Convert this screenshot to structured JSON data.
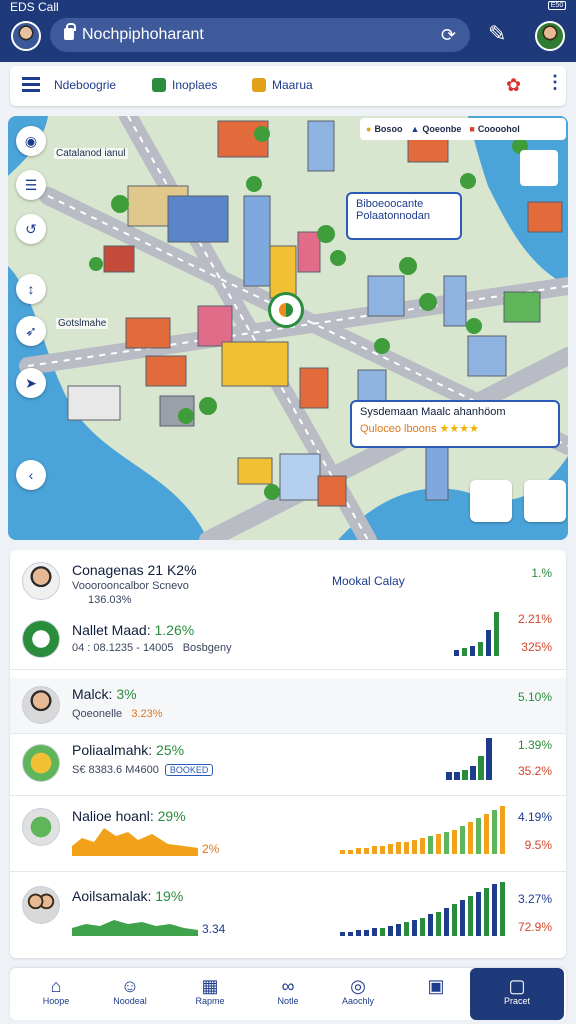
{
  "status": {
    "left": "EDS Call",
    "battery": "E50"
  },
  "browser": {
    "url": "Nochpiphoharant"
  },
  "header": {
    "nav": [
      {
        "label": "Ndeboogrie",
        "icon": "map-icon",
        "color": "#1e3c8c"
      },
      {
        "label": "Inoplaes",
        "icon": "chat-icon",
        "color": "#2a8d3c"
      },
      {
        "label": "Maarua",
        "icon": "bus-icon",
        "color": "#e1a21a"
      }
    ]
  },
  "map": {
    "legend": [
      "Bosoo",
      "Qoeonbe",
      "Coooohol"
    ],
    "label_top": "Catalanod ianul",
    "label_left": "Gotslmahe",
    "callout1": "Biboeoocante\nPolaatonnodan",
    "callout2_title": "Sysdemaan Maalc ahanhöom",
    "callout2_sub": "Quloceo lboons"
  },
  "list": {
    "rows": [
      {
        "title": "Conagenas 21 K2%",
        "sub": "Vooorooncalbor Scnevo",
        "sub2": "136.03%",
        "mid": "Mookal Calay",
        "val": "1.%",
        "val_color": "green"
      },
      {
        "title": "Nallet Maad:",
        "pct": "1.26%",
        "sub": "04 : 08.1235 - 14005",
        "sub2": "Bosbgeny",
        "val": "2.21%",
        "val2": "325%",
        "val_color": "red"
      },
      {
        "title": "Malck:",
        "pct": "3%",
        "sub": "Qoeonelle",
        "sub2": "3.23%",
        "val": "5.10%",
        "val_color": "green"
      },
      {
        "title": "Poliaalmahk:",
        "pct": "25%",
        "sub": "S€ 8383.6 M4600",
        "sub2": "BOOKED",
        "val": "1.39%",
        "val2": "35.2%",
        "val_color": "green"
      },
      {
        "title": "Nalioe hoanl:",
        "pct": "29%",
        "sub": "2%",
        "val": "4.19%",
        "val2": "9.5%",
        "val_color": "blue"
      },
      {
        "title": "Aoilsamalak:",
        "pct": "19%",
        "sub": "3.34",
        "val": "3.27%",
        "val2": "72.9%",
        "val_color": "blue"
      }
    ]
  },
  "bottom_nav": [
    {
      "label": "Hoope",
      "icon": "home-icon"
    },
    {
      "label": "Noodeal",
      "icon": "person-icon"
    },
    {
      "label": "Rapme",
      "icon": "chart-icon"
    },
    {
      "label": "Notle",
      "icon": "binoculars-icon"
    },
    {
      "label": "Aaochly",
      "icon": "compass-icon"
    },
    {
      "label": "",
      "icon": "calendar-icon"
    },
    {
      "label": "Pracet",
      "icon": "profile-icon"
    }
  ]
}
